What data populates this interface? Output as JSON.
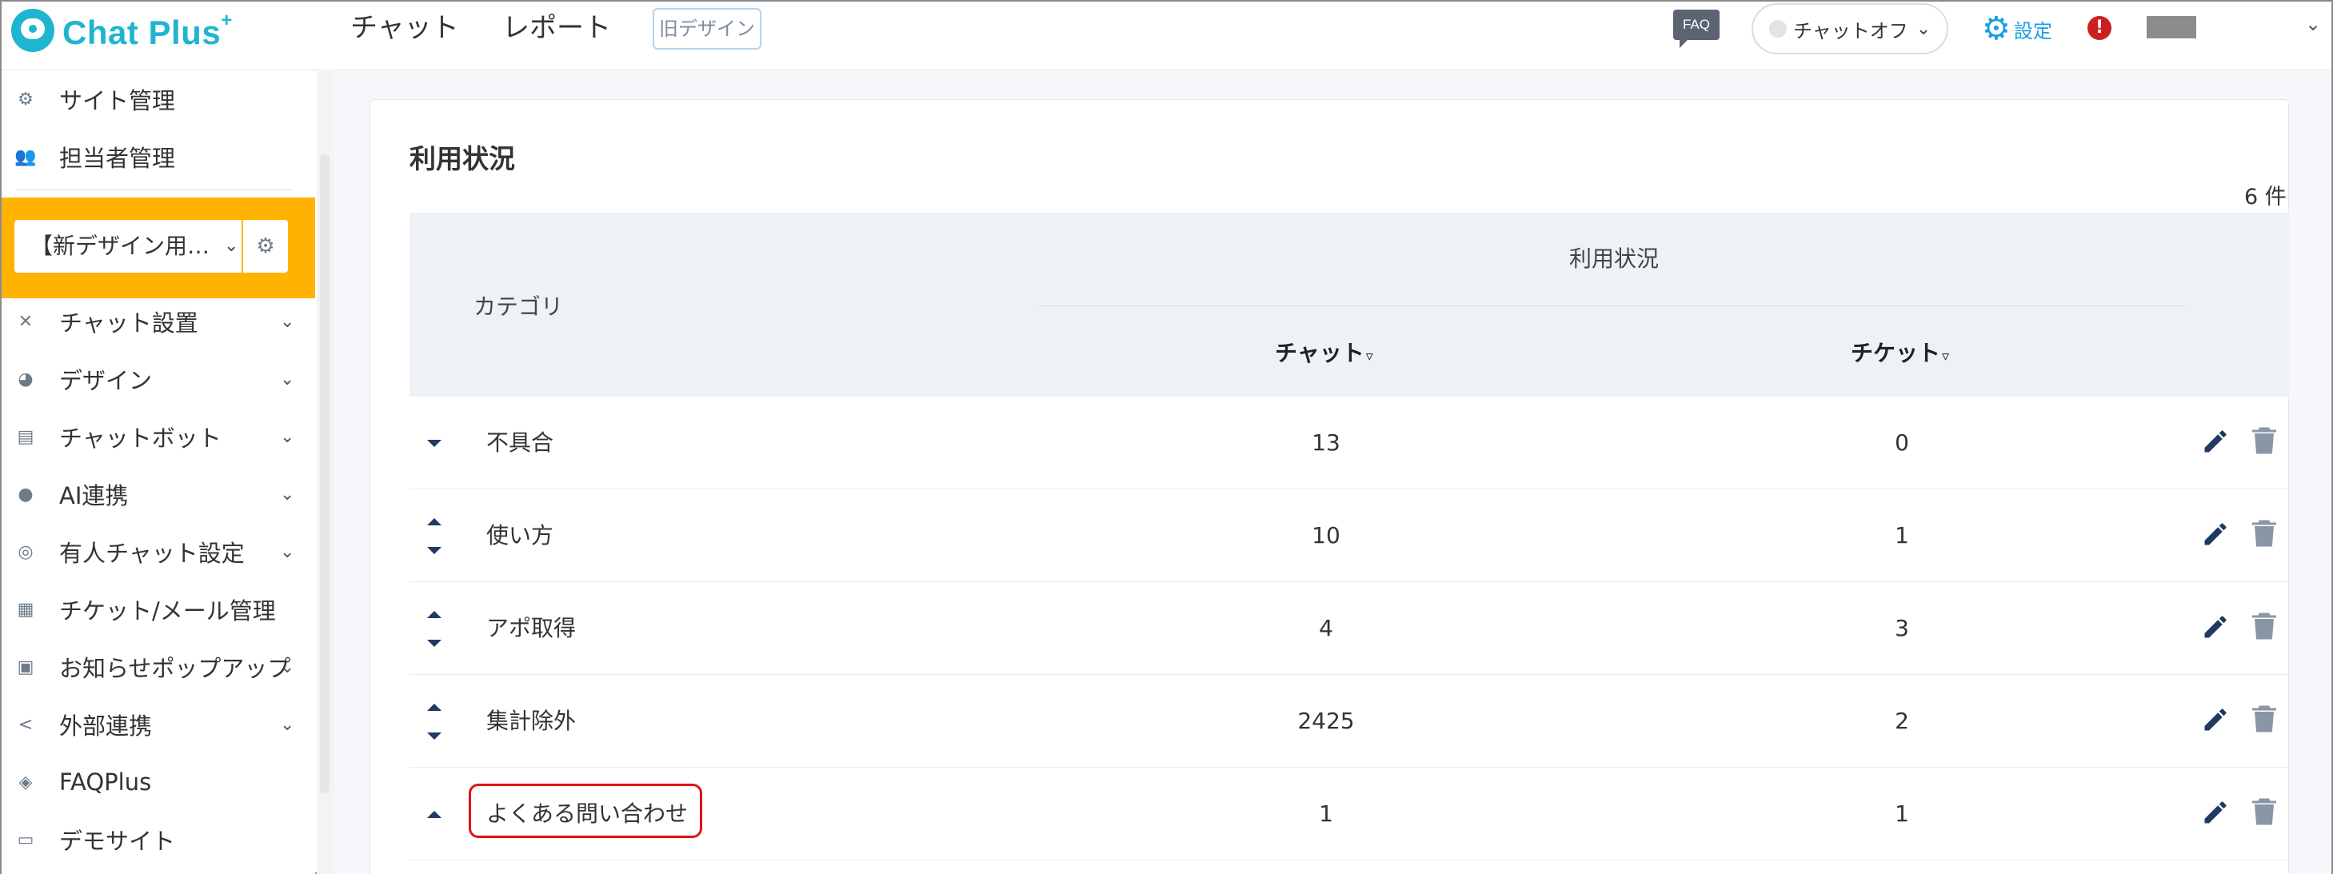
{
  "header": {
    "logo_text": "Chat Plus",
    "logo_plus": "+",
    "nav": [
      "チャット",
      "レポート"
    ],
    "old_design": "旧デザイン",
    "faq": "FAQ",
    "chat_status": "チャットオフ",
    "settings": "設定",
    "alert": "!"
  },
  "sidebar": {
    "items_top": [
      {
        "label": "サイト管理",
        "icon": "gear-icon"
      },
      {
        "label": "担当者管理",
        "icon": "users-icon"
      }
    ],
    "site_select": "【新デザイン用…",
    "items": [
      {
        "label": "チャット設置",
        "icon": "tools-icon",
        "chevron": true
      },
      {
        "label": "デザイン",
        "icon": "palette-icon",
        "chevron": true
      },
      {
        "label": "チャットボット",
        "icon": "chat-icon",
        "chevron": true
      },
      {
        "label": "AI連携",
        "icon": "bulb-icon",
        "chevron": true
      },
      {
        "label": "有人チャット設定",
        "icon": "headset-icon",
        "chevron": true
      },
      {
        "label": "チケット/メール管理",
        "icon": "list-icon",
        "chevron": false
      },
      {
        "label": "お知らせポップアップ",
        "icon": "popup-icon",
        "chevron": true
      },
      {
        "label": "外部連携",
        "icon": "share-icon",
        "chevron": true
      },
      {
        "label": "FAQPlus",
        "icon": "shield-icon",
        "chevron": false
      },
      {
        "label": "デモサイト",
        "icon": "browser-icon",
        "chevron": false
      }
    ]
  },
  "main": {
    "title": "利用状況",
    "count": "6 件",
    "columns": {
      "category": "カテゴリ",
      "usage": "利用状況",
      "chat": "チャット",
      "ticket": "チケット"
    },
    "rows": [
      {
        "name": "不具合",
        "chat": "13",
        "ticket": "0",
        "up": false,
        "down": true
      },
      {
        "name": "使い方",
        "chat": "10",
        "ticket": "1",
        "up": true,
        "down": true
      },
      {
        "name": "アポ取得",
        "chat": "4",
        "ticket": "3",
        "up": true,
        "down": true
      },
      {
        "name": "集計除外",
        "chat": "2425",
        "ticket": "2",
        "up": true,
        "down": true
      },
      {
        "name": "よくある問い合わせ",
        "chat": "1",
        "ticket": "1",
        "up": true,
        "down": false
      }
    ]
  },
  "colors": {
    "brand": "#1fb5d0",
    "highlight_frame": "#e01414",
    "site_select_bg": "#ffb300",
    "settings_blue": "#1a9ee0"
  }
}
